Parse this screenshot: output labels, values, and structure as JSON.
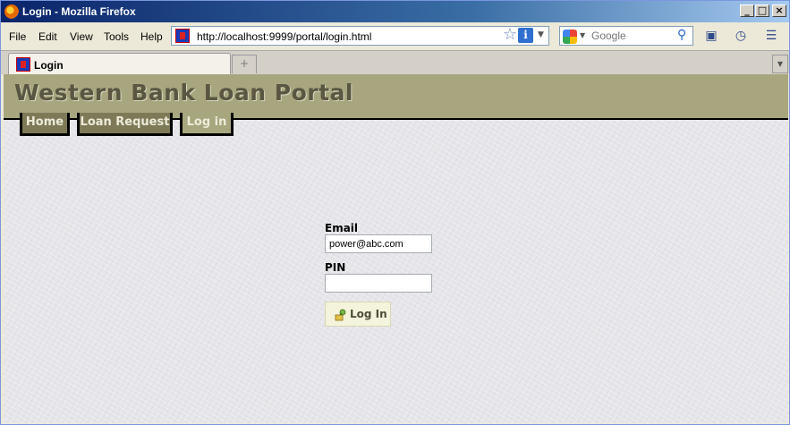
{
  "window": {
    "title": "Login - Mozilla Firefox"
  },
  "menu": {
    "file": "File",
    "edit": "Edit",
    "view": "View",
    "tools": "Tools",
    "help": "Help"
  },
  "navbar": {
    "url": "http://localhost:9999/portal/login.html",
    "search_placeholder": "Google"
  },
  "tabs": [
    {
      "label": "Login"
    }
  ],
  "page": {
    "site_title": "Western Bank Loan Portal",
    "nav": [
      "Home",
      "Loan Request",
      "Log in"
    ],
    "form": {
      "email_label": "Email",
      "email_value": "power@abc.com",
      "pin_label": "PIN",
      "pin_value": "",
      "login_label": "Log In"
    }
  },
  "colors": {
    "header_bg": "#a8a67e",
    "nav_tab_bg": "#7e7a58",
    "title_text": "#5a5642",
    "page_bg": "#e6e6ea",
    "login_button_bg": "#f4f4dc"
  },
  "icons": {
    "browser": "firefox-icon",
    "site": "favicon-icon",
    "bookmark_star": "star-icon",
    "site_info": "info-icon",
    "search_engine": "google-icon",
    "search_go": "magnifier-icon",
    "bookmarks": "bookmark-icon",
    "history": "history-icon",
    "page": "page-icon",
    "login": "key-icon"
  }
}
